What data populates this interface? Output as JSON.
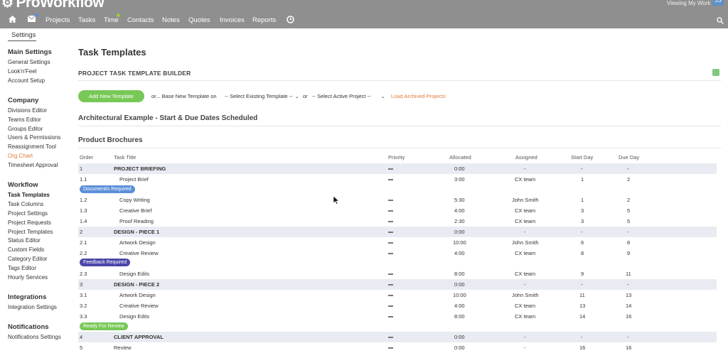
{
  "app": {
    "logo_text": "ProWorkflow",
    "viewing_text": "Viewing My Work",
    "avatar_initials": "JS"
  },
  "nav": {
    "items": [
      "Projects",
      "Tasks",
      "Time",
      "Contacts",
      "Notes",
      "Quotes",
      "Invoices",
      "Reports"
    ]
  },
  "settings_tab": "Settings",
  "sidebar": {
    "groups": [
      {
        "title": "Main Settings",
        "items": [
          "General Settings",
          "Look'n'Feel",
          "Account Setup"
        ]
      },
      {
        "title": "Company",
        "items": [
          "Divisions Editor",
          "Teams Editor",
          "Groups Editor",
          "Users & Permissions",
          "Reassignment Tool",
          "Org Chart",
          "Timesheet Approval"
        ]
      },
      {
        "title": "Workflow",
        "items": [
          "Task Templates",
          "Task Columns",
          "Project Settings",
          "Project Requests",
          "Project Templates",
          "Status Editor",
          "Custom Fields",
          "Category Editor",
          "Tags Editor",
          "Hourly Services"
        ]
      },
      {
        "title": "Integrations",
        "items": [
          "Integration Settings"
        ]
      },
      {
        "title": "Notifications",
        "items": [
          "Notifications Settings"
        ]
      }
    ]
  },
  "main": {
    "page_title": "Task Templates",
    "builder_title": "PROJECT TASK TEMPLATE BUILDER",
    "add_button": "Add New Template",
    "or_base": "or... Base New Template on",
    "select_existing": "-- Select Existing Template --",
    "or": "or",
    "select_active": "-- Select Active Project --",
    "load_archived": "Load Archived Projects",
    "template_1": "Architectural Example - Start & Due Dates Scheduled",
    "template_2": "Product Brochures"
  },
  "table": {
    "headers": {
      "order": "Order",
      "task_title": "Task Title",
      "priority": "Priority",
      "allocated": "Allocated",
      "assigned": "Assigned",
      "start_day": "Start Day",
      "due_day": "Due Day"
    },
    "rows": [
      {
        "order": "1",
        "title": "PROJECT BRIEFING",
        "allocated": "0:00",
        "assigned": "-",
        "start": "-",
        "due": "-"
      },
      {
        "order": "1.1",
        "title": "Project Brief",
        "allocated": "3:00",
        "assigned": "CX team",
        "start": "1",
        "due": "2"
      },
      {
        "order": "1.2",
        "title": "Copy Writing",
        "allocated": "5:30",
        "assigned": "John Smith",
        "start": "1",
        "due": "2"
      },
      {
        "order": "1.3",
        "title": "Creative Brief",
        "allocated": "4:00",
        "assigned": "CX team",
        "start": "3",
        "due": "5"
      },
      {
        "order": "1.4",
        "title": "Proof Reading",
        "allocated": "2:30",
        "assigned": "CX team",
        "start": "3",
        "due": "5"
      },
      {
        "order": "2",
        "title": "DESIGN - PIECE 1",
        "allocated": "0:00",
        "assigned": "-",
        "start": "-",
        "due": "-"
      },
      {
        "order": "2.1",
        "title": "Artwork Design",
        "allocated": "10:00",
        "assigned": "John Smith",
        "start": "6",
        "due": "8"
      },
      {
        "order": "2.2",
        "title": "Creative Review",
        "allocated": "4:00",
        "assigned": "CX team",
        "start": "8",
        "due": "9"
      },
      {
        "order": "2.3",
        "title": "Design Edits",
        "allocated": "8:00",
        "assigned": "CX team",
        "start": "9",
        "due": "11"
      },
      {
        "order": "3",
        "title": "DESIGN - PIECE 2",
        "allocated": "0:00",
        "assigned": "-",
        "start": "-",
        "due": "-"
      },
      {
        "order": "3.1",
        "title": "Artwork Design",
        "allocated": "10:00",
        "assigned": "John Smith",
        "start": "11",
        "due": "13"
      },
      {
        "order": "3.2",
        "title": "Creative Review",
        "allocated": "4:00",
        "assigned": "CX team",
        "start": "13",
        "due": "14"
      },
      {
        "order": "3.3",
        "title": "Design Edits",
        "allocated": "8:00",
        "assigned": "CX team",
        "start": "14",
        "due": "16"
      },
      {
        "order": "4",
        "title": "CLIENT APPROVAL",
        "allocated": "0:00",
        "assigned": "-",
        "start": "-",
        "due": "-"
      },
      {
        "order": "5",
        "title": "Review",
        "allocated": "0:00",
        "assigned": "-",
        "start": "16",
        "due": "16"
      }
    ],
    "badges": [
      {
        "text": "Document/s Required",
        "color": "#5b8fd9"
      },
      {
        "text": "Feedback Required",
        "color": "#4a46a8"
      },
      {
        "text": "Ready For Review",
        "color": "#78c857"
      }
    ]
  },
  "colors": {
    "topbar": "#8f8f8f",
    "accent_green": "#78c857",
    "link_orange": "#e07b39",
    "shaded_row": "#e8ecf2"
  }
}
